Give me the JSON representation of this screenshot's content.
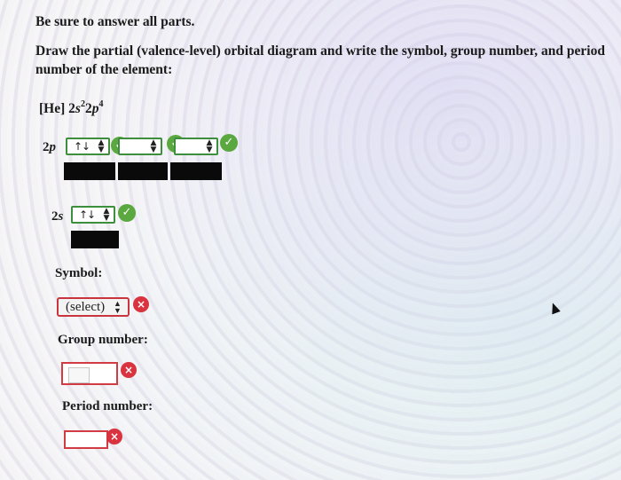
{
  "instructions": "Be sure to answer all parts.",
  "question": {
    "line1": "Draw the partial (valence-level) orbital diagram and write the symbol, group number, and period",
    "line2": "number of the element:"
  },
  "config": {
    "core": "[He] 2",
    "s_label": "s",
    "s_exp": "2",
    "p_coef": "2",
    "p_label": "p",
    "p_exp": "4"
  },
  "sublevel_2p": {
    "label_num": "2",
    "label_letter": "p",
    "boxes": [
      {
        "value": "↑↓",
        "status": "correct"
      },
      {
        "value": "",
        "status": "correct"
      },
      {
        "value": "",
        "status": "correct"
      }
    ]
  },
  "sublevel_2s": {
    "label_num": "2",
    "label_letter": "s",
    "boxes": [
      {
        "value": "↑↓",
        "status": "correct"
      }
    ]
  },
  "symbol": {
    "label": "Symbol:",
    "selected": "(select)",
    "status": "incorrect"
  },
  "group": {
    "label": "Group number:",
    "value": "",
    "status": "incorrect"
  },
  "period": {
    "label": "Period number:",
    "value": "",
    "status": "incorrect"
  },
  "icons": {
    "check": "✓",
    "cross": "×",
    "up": "▲",
    "down": "▼"
  },
  "colors": {
    "correct": "#5aa83f",
    "incorrect": "#d9333f"
  }
}
